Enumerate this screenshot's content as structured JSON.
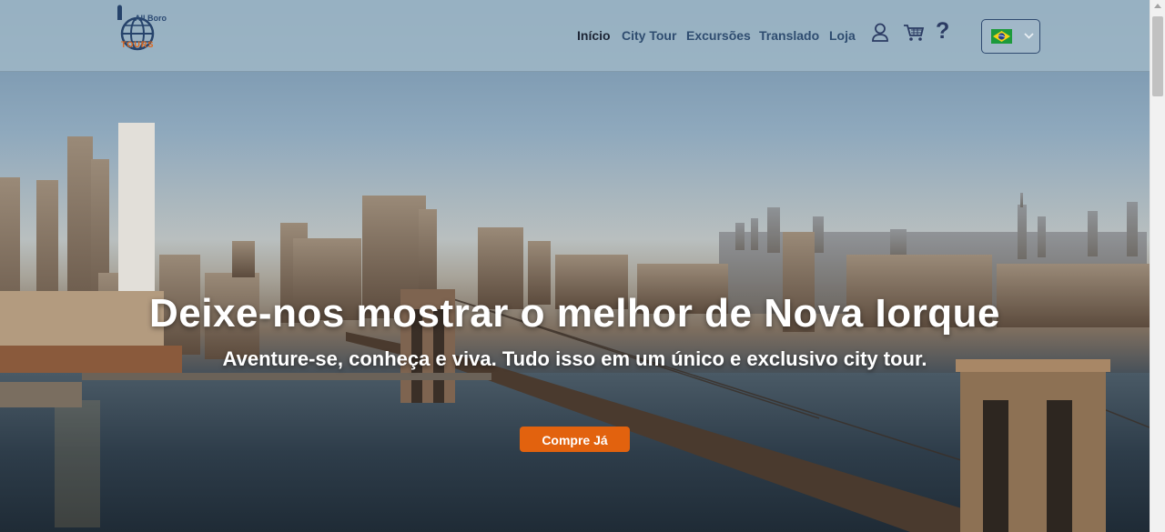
{
  "header": {
    "logo": {
      "line1": "All Boro",
      "line2": "TOURS"
    },
    "nav": [
      {
        "label": "Início",
        "active": true
      },
      {
        "label": "City Tour",
        "active": false
      },
      {
        "label": "Excursões",
        "active": false
      },
      {
        "label": "Translado",
        "active": false
      },
      {
        "label": "Loja",
        "active": false
      }
    ],
    "icons": {
      "user": "user-icon",
      "cart": "cart-icon",
      "help": "?"
    },
    "language": {
      "selected": "pt-BR",
      "flag": "brazil-flag-icon"
    }
  },
  "hero": {
    "title": "Deixe-nos mostrar o melhor de Nova Iorque",
    "subtitle": "Aventure-se, conheça e viva. Tudo isso em um único e exclusivo city tour.",
    "cta_label": "Compre Já",
    "background": "new-york-skyline-brooklyn-bridge-photo"
  },
  "colors": {
    "accent": "#e2620e",
    "nav_text": "#2f4d70",
    "nav_active": "#1d2535",
    "header_bg": "#a0b8c7"
  }
}
